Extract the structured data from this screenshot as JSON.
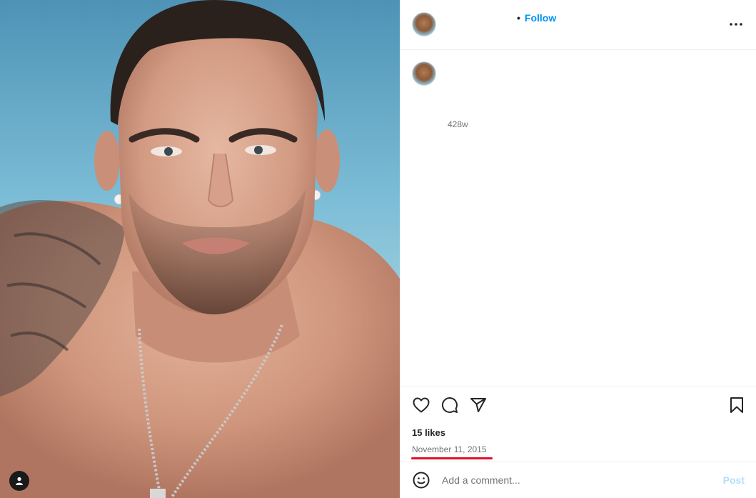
{
  "header": {
    "separator": "•",
    "follow_label": "Follow",
    "more_icon": "more-horizontal-icon"
  },
  "comments": {
    "time_ago": "428w"
  },
  "actions": {
    "like_icon": "heart-icon",
    "comment_icon": "comment-icon",
    "share_icon": "share-icon",
    "save_icon": "bookmark-icon"
  },
  "likes": {
    "text": "15 likes"
  },
  "post_date": {
    "text": "November 11, 2015",
    "highlight_color": "#e0102a"
  },
  "comment_box": {
    "emoji_icon": "emoji-icon",
    "placeholder": "Add a comment...",
    "post_label": "Post"
  },
  "media": {
    "tagged_user_icon": "user-icon"
  },
  "colors": {
    "accent": "#0095f6",
    "post_disabled": "#b2dffc",
    "muted_text": "#737373"
  }
}
